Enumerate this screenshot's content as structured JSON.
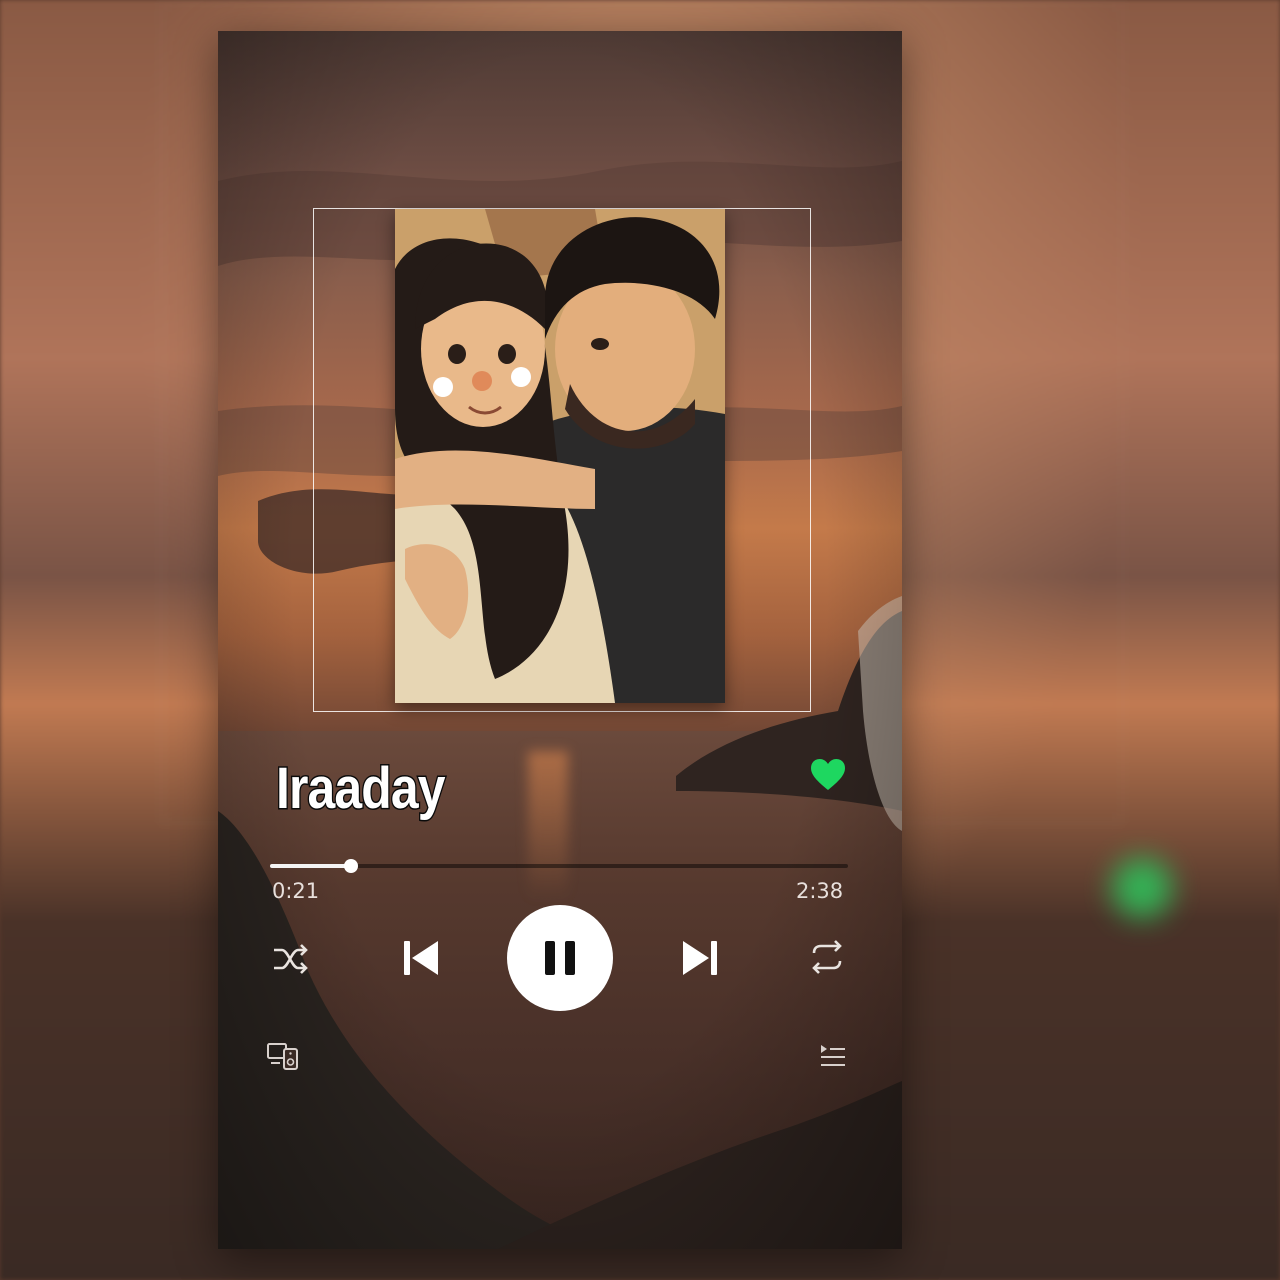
{
  "track": {
    "title": "Iraaday",
    "liked": true
  },
  "playback": {
    "elapsed": "0:21",
    "total": "2:38",
    "progress": 0.14,
    "state": "playing"
  },
  "controls": {
    "shuffle_icon": "shuffle-icon",
    "previous_icon": "skip-previous-icon",
    "play_pause_icon": "pause-icon",
    "next_icon": "skip-next-icon",
    "repeat_icon": "repeat-icon",
    "devices_icon": "connect-devices-icon",
    "queue_icon": "queue-icon"
  },
  "colors": {
    "accent": "#1ed760",
    "text": "#ffffff"
  }
}
